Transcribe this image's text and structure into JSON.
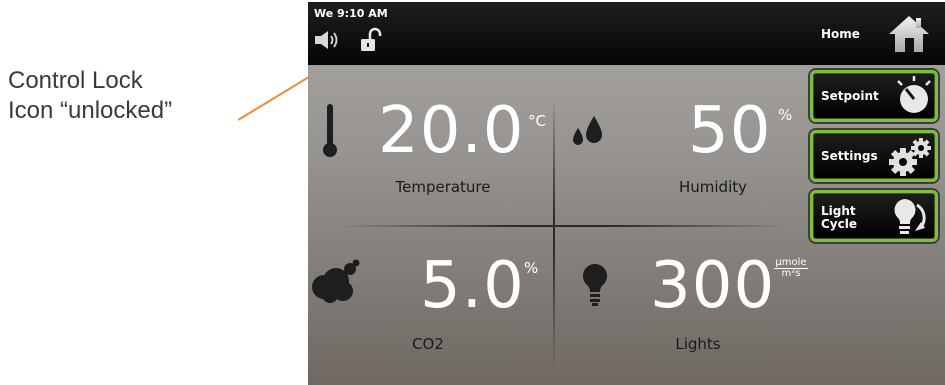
{
  "annotation": {
    "line1": "Control Lock",
    "line2": "Icon “unlocked”",
    "arrow_color": "#f08c3a"
  },
  "status_bar": {
    "time": "We 9:10 AM",
    "speaker_icon": "speaker-icon",
    "lock_icon": "unlocked-padlock-icon",
    "home_label": "Home",
    "home_icon": "home-icon"
  },
  "tiles": {
    "temperature": {
      "value": "20.0",
      "unit": "°C",
      "label": "Temperature",
      "icon": "thermometer-icon"
    },
    "humidity": {
      "value": "50",
      "unit": "%",
      "label": "Humidity",
      "icon": "water-drops-icon"
    },
    "co2": {
      "value": "5.0",
      "unit": "%",
      "label": "CO2",
      "icon": "cloud-icon"
    },
    "lights": {
      "value": "300",
      "unit_numerator": "µmole",
      "unit_denominator": "m²s",
      "label": "Lights",
      "icon": "light-bulb-icon"
    }
  },
  "side_buttons": [
    {
      "label": "Setpoint",
      "icon": "dial-icon"
    },
    {
      "label": "Settings",
      "icon": "gears-icon"
    },
    {
      "label_line1": "Light",
      "label_line2": "Cycle",
      "icon": "bulb-cycle-icon"
    }
  ],
  "colors": {
    "accent_green": "#7fbd3c",
    "status_bar": "#0a0a0a",
    "value_text": "#ffffff",
    "label_text": "#1a1a1a"
  }
}
